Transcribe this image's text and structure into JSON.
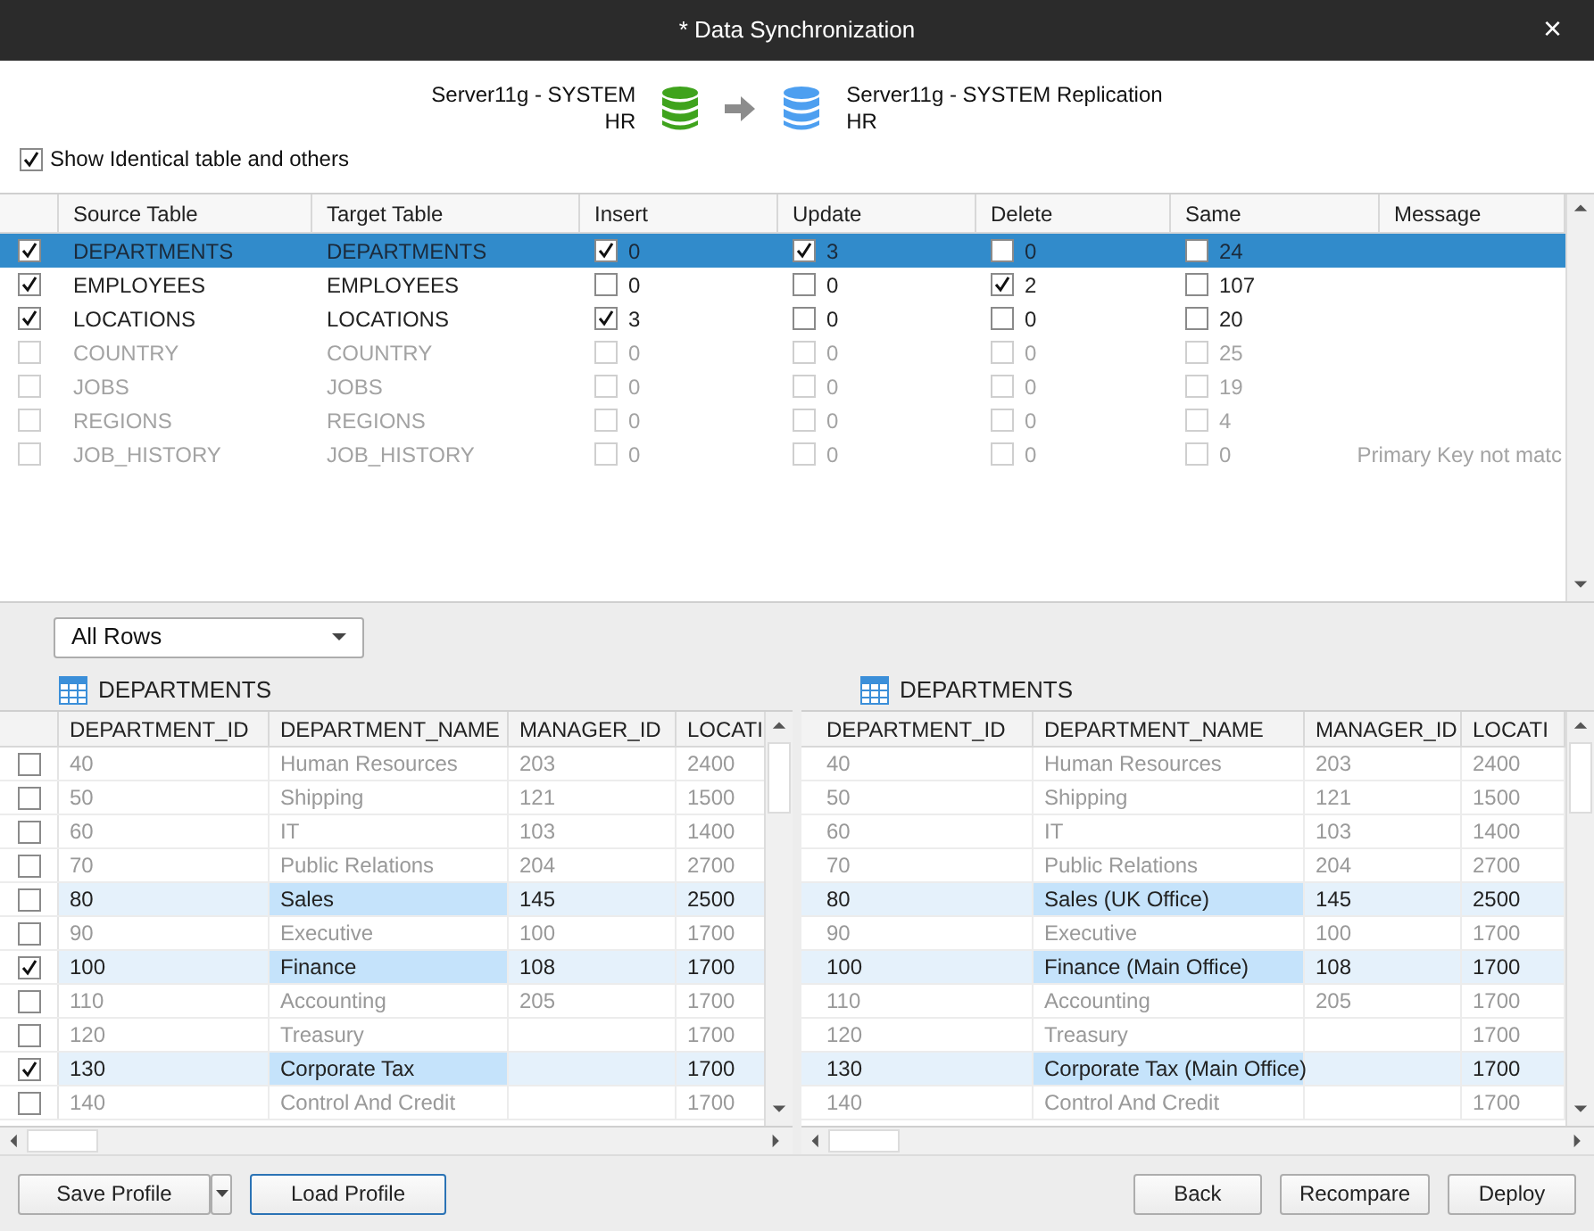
{
  "window": {
    "title": "* Data Synchronization",
    "close": "×"
  },
  "connection": {
    "source": {
      "name": "Server11g - SYSTEM",
      "schema": "HR"
    },
    "target": {
      "name": "Server11g - SYSTEM Replication",
      "schema": "HR"
    }
  },
  "show_identical": {
    "label": "Show Identical table and others",
    "checked": true
  },
  "tables": {
    "columns": [
      "Source Table",
      "Target Table",
      "Insert",
      "Update",
      "Delete",
      "Same",
      "Message"
    ],
    "rows": [
      {
        "selected": true,
        "checked": true,
        "dimmed": false,
        "source": "DEPARTMENTS",
        "target": "DEPARTMENTS",
        "insert": {
          "checked": true,
          "count": "0"
        },
        "update": {
          "checked": true,
          "count": "3"
        },
        "delete": {
          "checked": false,
          "count": "0"
        },
        "same": {
          "checked": false,
          "count": "24"
        }
      },
      {
        "selected": false,
        "checked": true,
        "dimmed": false,
        "source": "EMPLOYEES",
        "target": "EMPLOYEES",
        "insert": {
          "checked": false,
          "count": "0"
        },
        "update": {
          "checked": false,
          "count": "0"
        },
        "delete": {
          "checked": true,
          "count": "2"
        },
        "same": {
          "checked": false,
          "count": "107"
        }
      },
      {
        "selected": false,
        "checked": true,
        "dimmed": false,
        "source": "LOCATIONS",
        "target": "LOCATIONS",
        "insert": {
          "checked": true,
          "count": "3"
        },
        "update": {
          "checked": false,
          "count": "0"
        },
        "delete": {
          "checked": false,
          "count": "0"
        },
        "same": {
          "checked": false,
          "count": "20"
        }
      },
      {
        "selected": false,
        "checked": false,
        "dimmed": true,
        "source": "COUNTRY",
        "target": "COUNTRY",
        "insert": {
          "checked": false,
          "count": "0"
        },
        "update": {
          "checked": false,
          "count": "0"
        },
        "delete": {
          "checked": false,
          "count": "0"
        },
        "same": {
          "checked": false,
          "count": "25"
        }
      },
      {
        "selected": false,
        "checked": false,
        "dimmed": true,
        "source": "JOBS",
        "target": "JOBS",
        "insert": {
          "checked": false,
          "count": "0"
        },
        "update": {
          "checked": false,
          "count": "0"
        },
        "delete": {
          "checked": false,
          "count": "0"
        },
        "same": {
          "checked": false,
          "count": "19"
        }
      },
      {
        "selected": false,
        "checked": false,
        "dimmed": true,
        "source": "REGIONS",
        "target": "REGIONS",
        "insert": {
          "checked": false,
          "count": "0"
        },
        "update": {
          "checked": false,
          "count": "0"
        },
        "delete": {
          "checked": false,
          "count": "0"
        },
        "same": {
          "checked": false,
          "count": "4"
        }
      },
      {
        "selected": false,
        "checked": false,
        "dimmed": true,
        "source": "JOB_HISTORY",
        "target": "JOB_HISTORY",
        "insert": {
          "checked": false,
          "count": "0"
        },
        "update": {
          "checked": false,
          "count": "0"
        },
        "delete": {
          "checked": false,
          "count": "0"
        },
        "same": {
          "checked": false,
          "count": "0"
        },
        "message": "Primary Key not matc"
      }
    ]
  },
  "filter": {
    "value": "All Rows"
  },
  "source_grid": {
    "title": "DEPARTMENTS",
    "columns": [
      "DEPARTMENT_ID",
      "DEPARTMENT_NAME",
      "MANAGER_ID",
      "LOCATI"
    ],
    "rows": [
      {
        "checked": false,
        "changed": false,
        "id": "40",
        "name": "Human Resources",
        "manager": "203",
        "location": "2400"
      },
      {
        "checked": false,
        "changed": false,
        "id": "50",
        "name": "Shipping",
        "manager": "121",
        "location": "1500"
      },
      {
        "checked": false,
        "changed": false,
        "id": "60",
        "name": "IT",
        "manager": "103",
        "location": "1400"
      },
      {
        "checked": false,
        "changed": false,
        "id": "70",
        "name": "Public Relations",
        "manager": "204",
        "location": "2700"
      },
      {
        "checked": false,
        "changed": true,
        "id": "80",
        "name": "Sales",
        "manager": "145",
        "location": "2500"
      },
      {
        "checked": false,
        "changed": false,
        "id": "90",
        "name": "Executive",
        "manager": "100",
        "location": "1700"
      },
      {
        "checked": true,
        "changed": true,
        "id": "100",
        "name": "Finance",
        "manager": "108",
        "location": "1700"
      },
      {
        "checked": false,
        "changed": false,
        "id": "110",
        "name": "Accounting",
        "manager": "205",
        "location": "1700"
      },
      {
        "checked": false,
        "changed": false,
        "id": "120",
        "name": "Treasury",
        "location": "1700"
      },
      {
        "checked": true,
        "changed": true,
        "id": "130",
        "name": "Corporate Tax",
        "location": "1700"
      },
      {
        "checked": false,
        "changed": false,
        "id": "140",
        "name": "Control And Credit",
        "location": "1700"
      }
    ]
  },
  "target_grid": {
    "title": "DEPARTMENTS",
    "columns": [
      "DEPARTMENT_ID",
      "DEPARTMENT_NAME",
      "MANAGER_ID",
      "LOCATI"
    ],
    "rows": [
      {
        "changed": false,
        "id": "40",
        "name": "Human Resources",
        "manager": "203",
        "location": "2400"
      },
      {
        "changed": false,
        "id": "50",
        "name": "Shipping",
        "manager": "121",
        "location": "1500"
      },
      {
        "changed": false,
        "id": "60",
        "name": "IT",
        "manager": "103",
        "location": "1400"
      },
      {
        "changed": false,
        "id": "70",
        "name": "Public Relations",
        "manager": "204",
        "location": "2700"
      },
      {
        "changed": true,
        "id": "80",
        "name": "Sales (UK Office)",
        "manager": "145",
        "location": "2500"
      },
      {
        "changed": false,
        "id": "90",
        "name": "Executive",
        "manager": "100",
        "location": "1700"
      },
      {
        "changed": true,
        "id": "100",
        "name": "Finance (Main Office)",
        "manager": "108",
        "location": "1700"
      },
      {
        "changed": false,
        "id": "110",
        "name": "Accounting",
        "manager": "205",
        "location": "1700"
      },
      {
        "changed": false,
        "id": "120",
        "name": "Treasury",
        "location": "1700"
      },
      {
        "changed": true,
        "id": "130",
        "name": "Corporate Tax (Main Office)",
        "location": "1700"
      },
      {
        "changed": false,
        "id": "140",
        "name": "Control And Credit",
        "location": "1700"
      }
    ]
  },
  "footer": {
    "left": [
      {
        "label": "Save Profile",
        "kind": "split"
      },
      {
        "label": "Load Profile",
        "kind": "focused"
      }
    ],
    "right": [
      {
        "label": "Back",
        "kind": "plain"
      },
      {
        "label": "Recompare",
        "kind": "plain"
      },
      {
        "label": "Deploy",
        "kind": "plain"
      }
    ]
  }
}
